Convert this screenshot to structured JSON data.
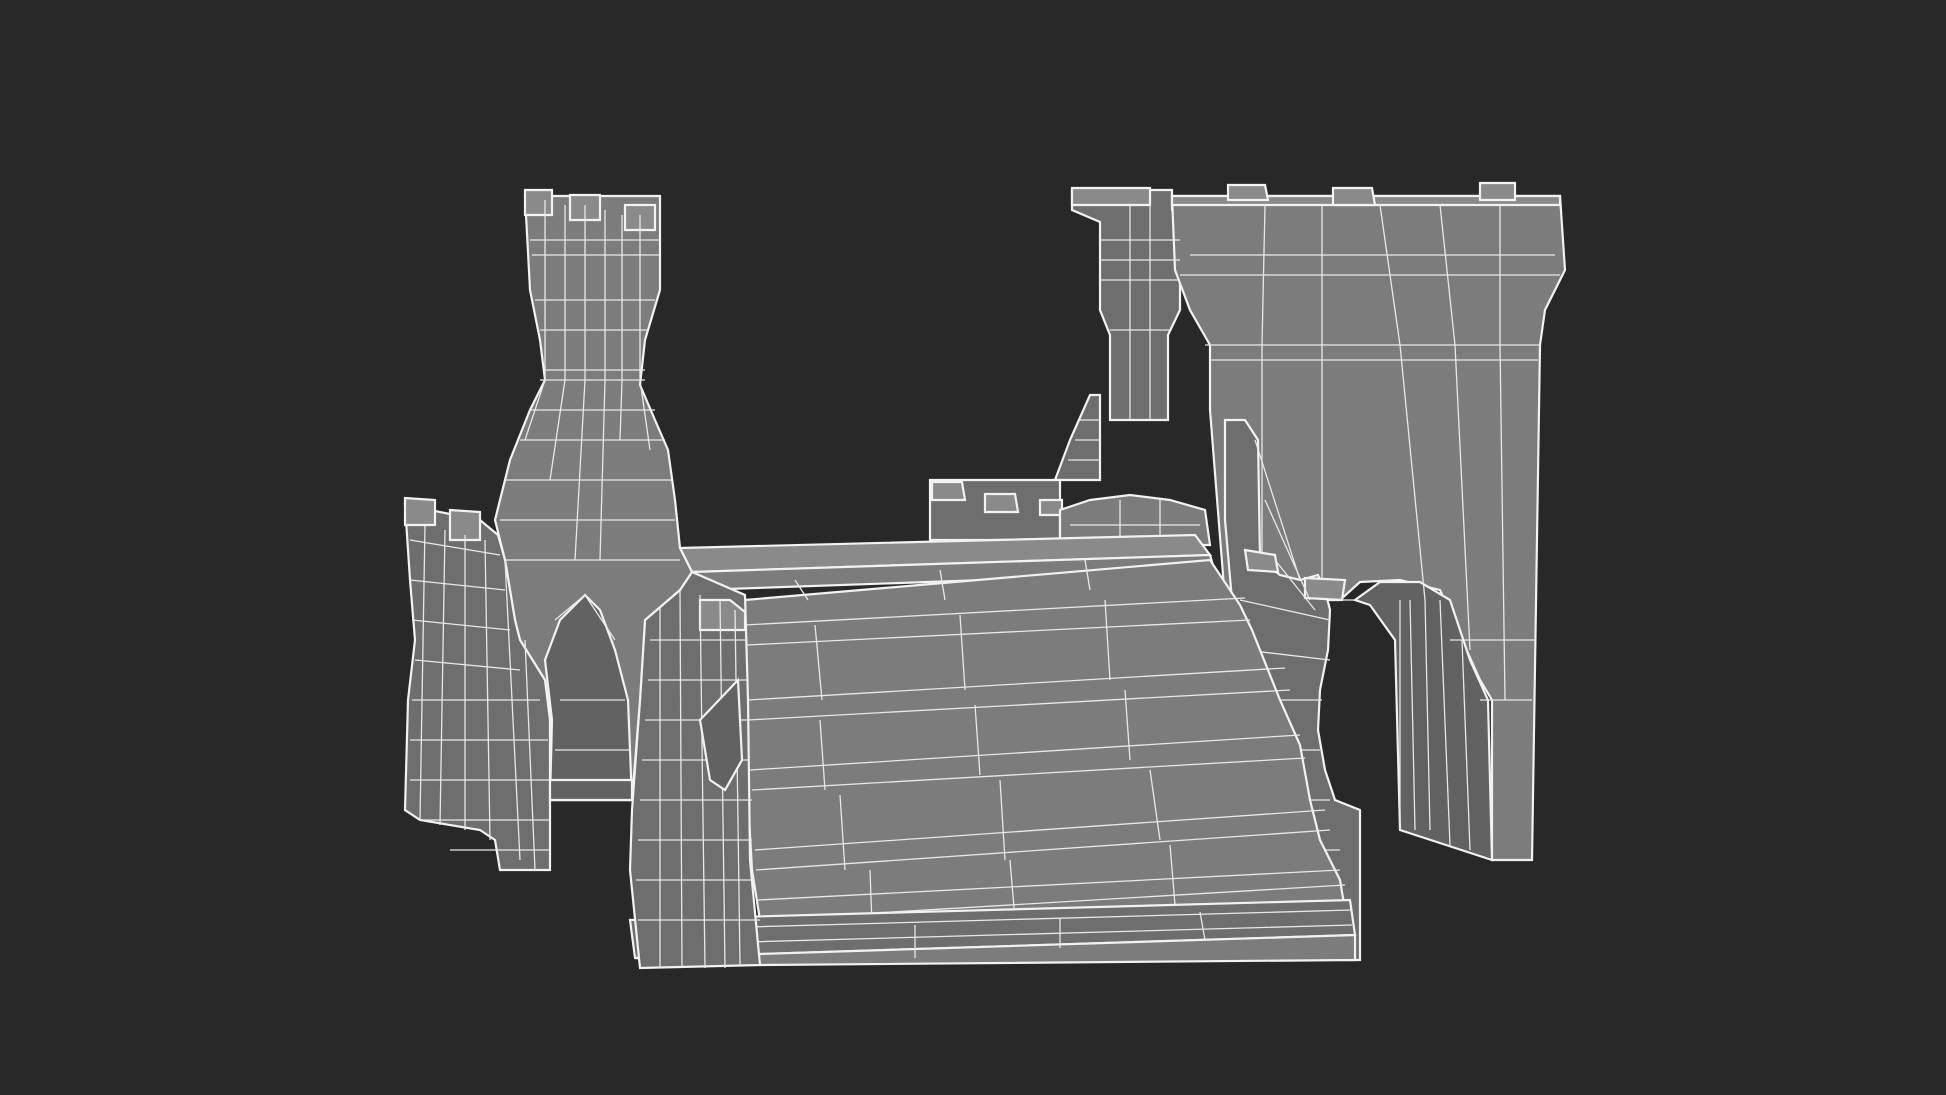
{
  "scene": {
    "background_color": "#282828",
    "mesh_color": "#7c7c7c",
    "wire_color": "#e8e8e8",
    "render_mode": "wireframe-on-shaded"
  }
}
